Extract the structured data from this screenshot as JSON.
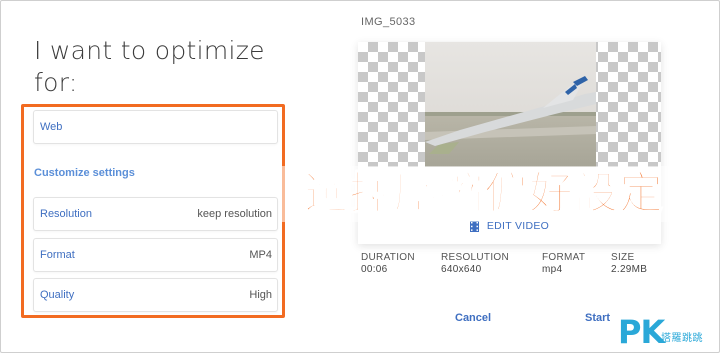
{
  "left_panel": {
    "heading": "I want to optimize for:",
    "web_option": "Web",
    "customize_title": "Customize settings",
    "settings": [
      {
        "label": "Resolution",
        "value": "keep resolution"
      },
      {
        "label": "Format",
        "value": "MP4"
      },
      {
        "label": "Quality",
        "value": "High"
      }
    ]
  },
  "preview": {
    "filename": "IMG_5033",
    "edit_video_label": "EDIT VIDEO",
    "meta": [
      {
        "label": "DURATION",
        "value": "00:06"
      },
      {
        "label": "RESOLUTION",
        "value": "640x640"
      },
      {
        "label": "FORMAT",
        "value": "mp4"
      },
      {
        "label": "SIZE",
        "value": "2.29MB"
      }
    ]
  },
  "actions": {
    "cancel_label": "Cancel",
    "start_label": "Start"
  },
  "overlay": {
    "annotation_text": "選擇壓縮偏好設定"
  },
  "watermark": {
    "brand": "PK",
    "sub": "塔羅跳跳"
  },
  "colors": {
    "accent_orange": "#f26b21",
    "link_blue": "#3f6fc1",
    "watermark_blue": "#2aa8d8"
  },
  "icons": {
    "edit_video_icon": "film-icon"
  }
}
